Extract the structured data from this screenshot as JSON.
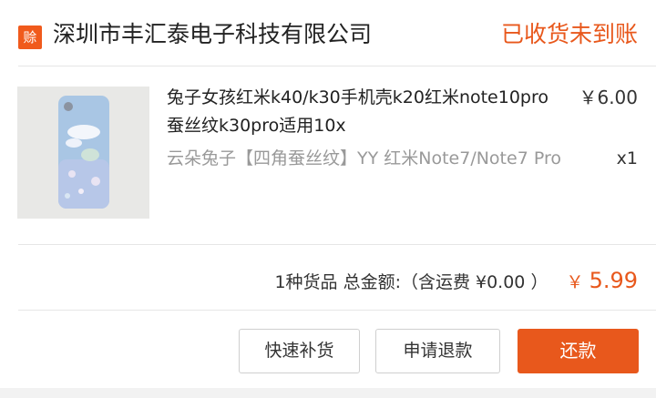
{
  "shop": {
    "badge_text": "赊",
    "name": "深圳市丰汇泰电子科技有限公司",
    "status": "已收货未到账"
  },
  "item": {
    "image_alt": "blue phone case with clouds and rabbit",
    "title": "兔子女孩红米k40/k30手机壳k20红米note10pro蚕丝纹k30pro适用10x",
    "price": "￥6.00",
    "sku": "云朵兔子【四角蚕丝纹】YY 红米Note7/Note7 Pro",
    "quantity": "x1"
  },
  "summary": {
    "text": "1种货品 总金额:（含运费 ¥0.00 ）",
    "currency": "￥",
    "total": "5.99"
  },
  "actions": {
    "restock_label": "快速补货",
    "refund_label": "申请退款",
    "pay_label": "还款"
  },
  "colors": {
    "accent": "#e8581c",
    "text": "#222222",
    "muted": "#999999"
  }
}
